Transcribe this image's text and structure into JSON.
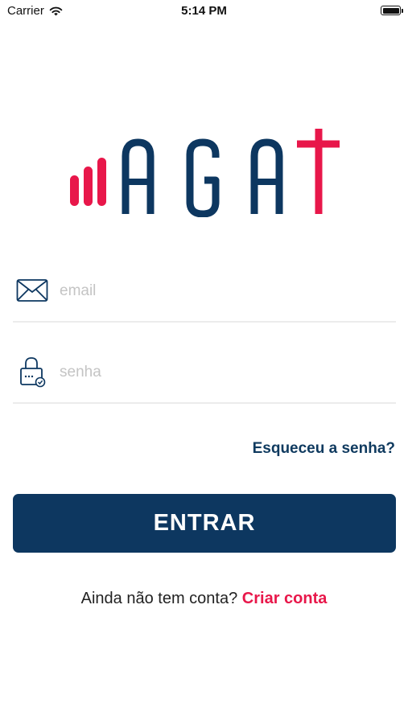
{
  "status_bar": {
    "carrier": "Carrier",
    "time": "5:14 PM",
    "wifi_icon": "wifi-icon",
    "battery_icon": "battery-icon"
  },
  "logo": {
    "name": "AGAT",
    "colors": {
      "navy": "#0d3760",
      "red": "#e8174a"
    }
  },
  "form": {
    "email": {
      "placeholder": "email",
      "value": "",
      "icon": "envelope-icon"
    },
    "password": {
      "placeholder": "senha",
      "value": "",
      "icon": "lock-icon"
    },
    "forgot_label": "Esqueceu a senha?",
    "submit_label": "ENTRAR"
  },
  "signup": {
    "prompt": "Ainda não tem conta?",
    "link_label": "Criar conta"
  },
  "colors": {
    "primary": "#0d3760",
    "accent": "#e8174a",
    "placeholder": "#c4c4c4",
    "divider": "#ececec"
  }
}
